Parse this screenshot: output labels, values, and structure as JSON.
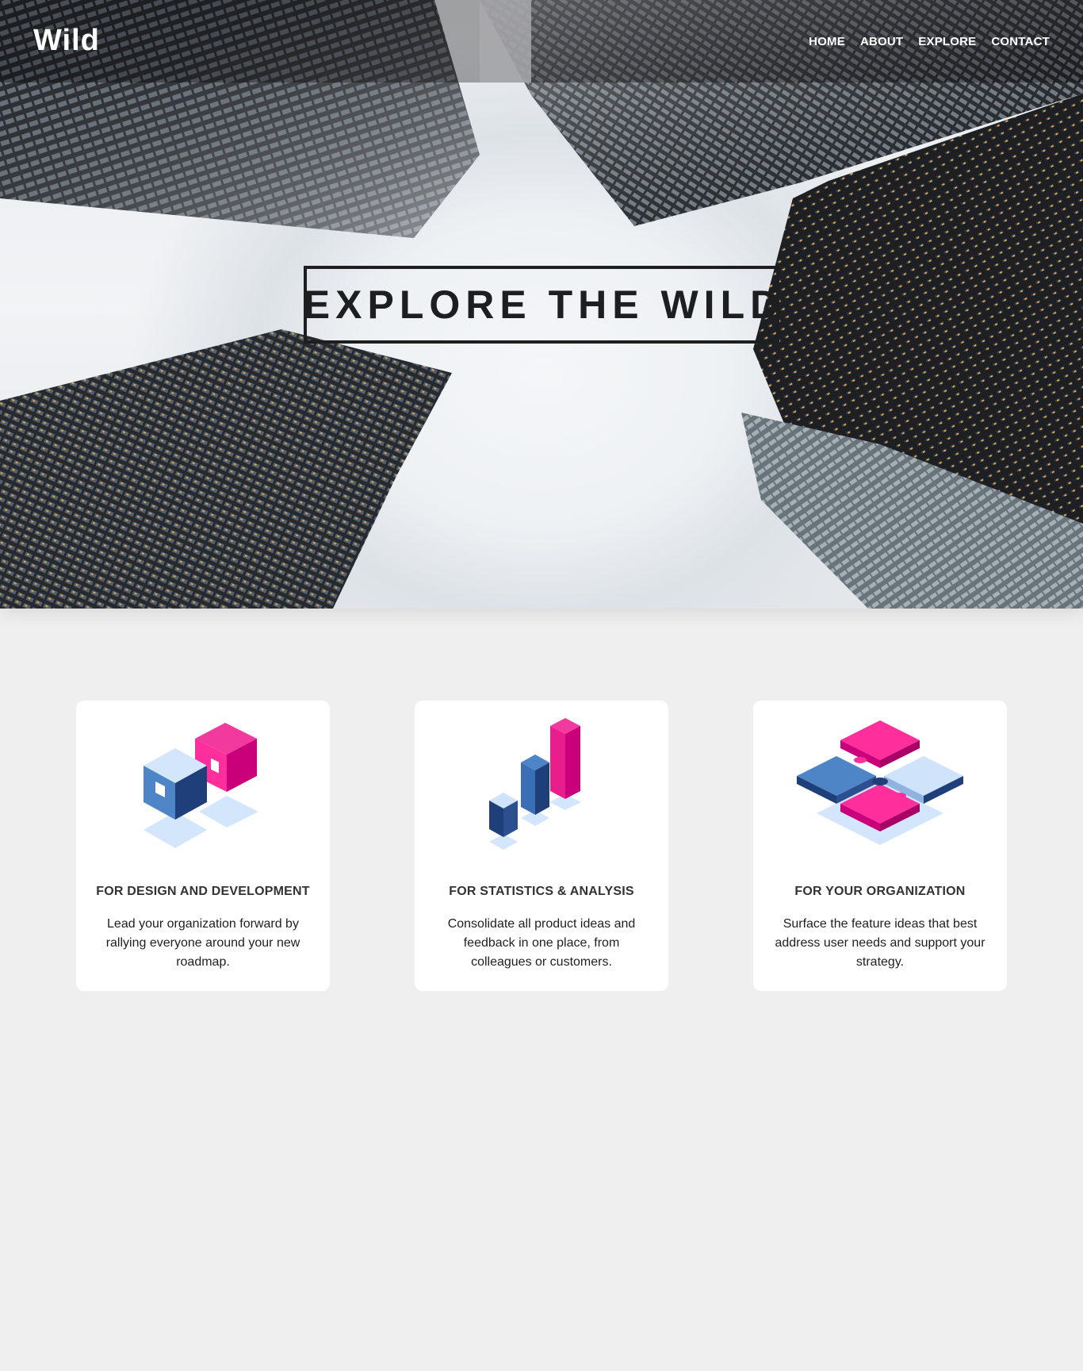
{
  "brand": {
    "logo": "Wild"
  },
  "nav": {
    "items": [
      {
        "label": "HOME"
      },
      {
        "label": "ABOUT"
      },
      {
        "label": "EXPLORE"
      },
      {
        "label": "CONTACT"
      }
    ]
  },
  "hero": {
    "title": "EXPLORE THE WILD",
    "image": "skyscrapers-looking-up"
  },
  "features": [
    {
      "icon": "isometric-cubes-icon",
      "title": "FOR DESIGN AND DEVELOPMENT",
      "text": "Lead your organization forward by rallying everyone around your new roadmap."
    },
    {
      "icon": "isometric-bar-chart-icon",
      "title": "FOR STATISTICS & ANALYSIS",
      "text": "Consolidate all product ideas and feedback in one place, from colleagues or customers."
    },
    {
      "icon": "isometric-puzzle-icon",
      "title": "FOR YOUR ORGANIZATION",
      "text": "Surface the feature ideas that best address user needs and support your strategy."
    }
  ],
  "colors": {
    "accent_pink": "#e91e8c",
    "accent_blue": "#4d85c7",
    "dark_blue": "#1e3f7a",
    "light_blue": "#cfe3fa",
    "page_bg": "#efefef"
  }
}
